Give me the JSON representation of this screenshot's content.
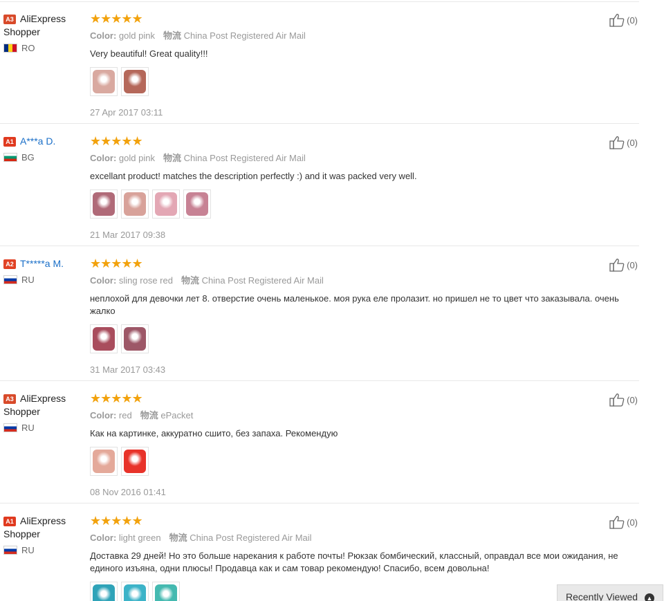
{
  "colors": {
    "star": "#f2a20d",
    "link": "#1a6fc8",
    "badge": "#e03a1f",
    "divider": "#e8e8e8"
  },
  "reviews": [
    {
      "level": "A3",
      "user": "AliExpress Shopper",
      "user_is_link": false,
      "country": "RO",
      "flag": [
        "#002b7f",
        "#fcd116",
        "#ce1126"
      ],
      "stars": "★★★★★",
      "color_label": "Color:",
      "color": "gold pink",
      "ship_label": "物流",
      "ship": "China Post Registered Air Mail",
      "text": "Very beautiful! Great quality!!!",
      "photos": [
        "#d9a9a0",
        "#b5685a"
      ],
      "date": "27 Apr 2017 03:11",
      "helpful": "(0)"
    },
    {
      "level": "A1",
      "user": "A***a D.",
      "user_is_link": true,
      "country": "BG",
      "flag": [
        "#ffffff",
        "#00966e",
        "#d62612"
      ],
      "stars": "★★★★★",
      "color_label": "Color:",
      "color": "gold pink",
      "ship_label": "物流",
      "ship": "China Post Registered Air Mail",
      "text": "excellant product! matches the description perfectly :) and it was packed very well.",
      "photos": [
        "#b06a78",
        "#d8a29a",
        "#e3a7b4",
        "#c78294"
      ],
      "date": "21 Mar 2017 09:38",
      "helpful": "(0)"
    },
    {
      "level": "A2",
      "user": "T*****a M.",
      "user_is_link": true,
      "country": "RU",
      "flag": [
        "#ffffff",
        "#0039a6",
        "#d52b1e"
      ],
      "stars": "★★★★★",
      "color_label": "Color:",
      "color": "sling rose red",
      "ship_label": "物流",
      "ship": "China Post Registered Air Mail",
      "text": "неплохой для девочки лет 8. отверстие очень маленькое. моя рука еле пролазит. но пришел не то цвет что заказывала. очень жалко",
      "photos": [
        "#a94d5d",
        "#9d5767"
      ],
      "date": "31 Mar 2017 03:43",
      "helpful": "(0)"
    },
    {
      "level": "A3",
      "user": "AliExpress Shopper",
      "user_is_link": false,
      "country": "RU",
      "flag": [
        "#ffffff",
        "#0039a6",
        "#d52b1e"
      ],
      "stars": "★★★★★",
      "color_label": "Color:",
      "color": "red",
      "ship_label": "物流",
      "ship": "ePacket",
      "text": "Как на картинке, аккуратно сшито, без запаха. Рекомендую",
      "photos": [
        "#e4a99a",
        "#e8332a"
      ],
      "date": "08 Nov 2016 01:41",
      "helpful": "(0)"
    },
    {
      "level": "A1",
      "user": "AliExpress Shopper",
      "user_is_link": false,
      "country": "RU",
      "flag": [
        "#ffffff",
        "#0039a6",
        "#d52b1e"
      ],
      "stars": "★★★★★",
      "color_label": "Color:",
      "color": "light green",
      "ship_label": "物流",
      "ship": "China Post Registered Air Mail",
      "text": "Доставка 29 дней! Но это больше нарекания к работе почты! Рюкзак бомбический, классный, оправдал все мои ожидания, не единого изъяна, одни плюсы! Продавца как и сам товар рекомендую! Спасибо, всем довольна!",
      "photos": [
        "#2fa3b8",
        "#3cb3c8",
        "#44b9b0"
      ],
      "date": "",
      "helpful": "(0)"
    }
  ],
  "recently_viewed": {
    "label": "Recently Viewed",
    "arrow": "▲"
  }
}
